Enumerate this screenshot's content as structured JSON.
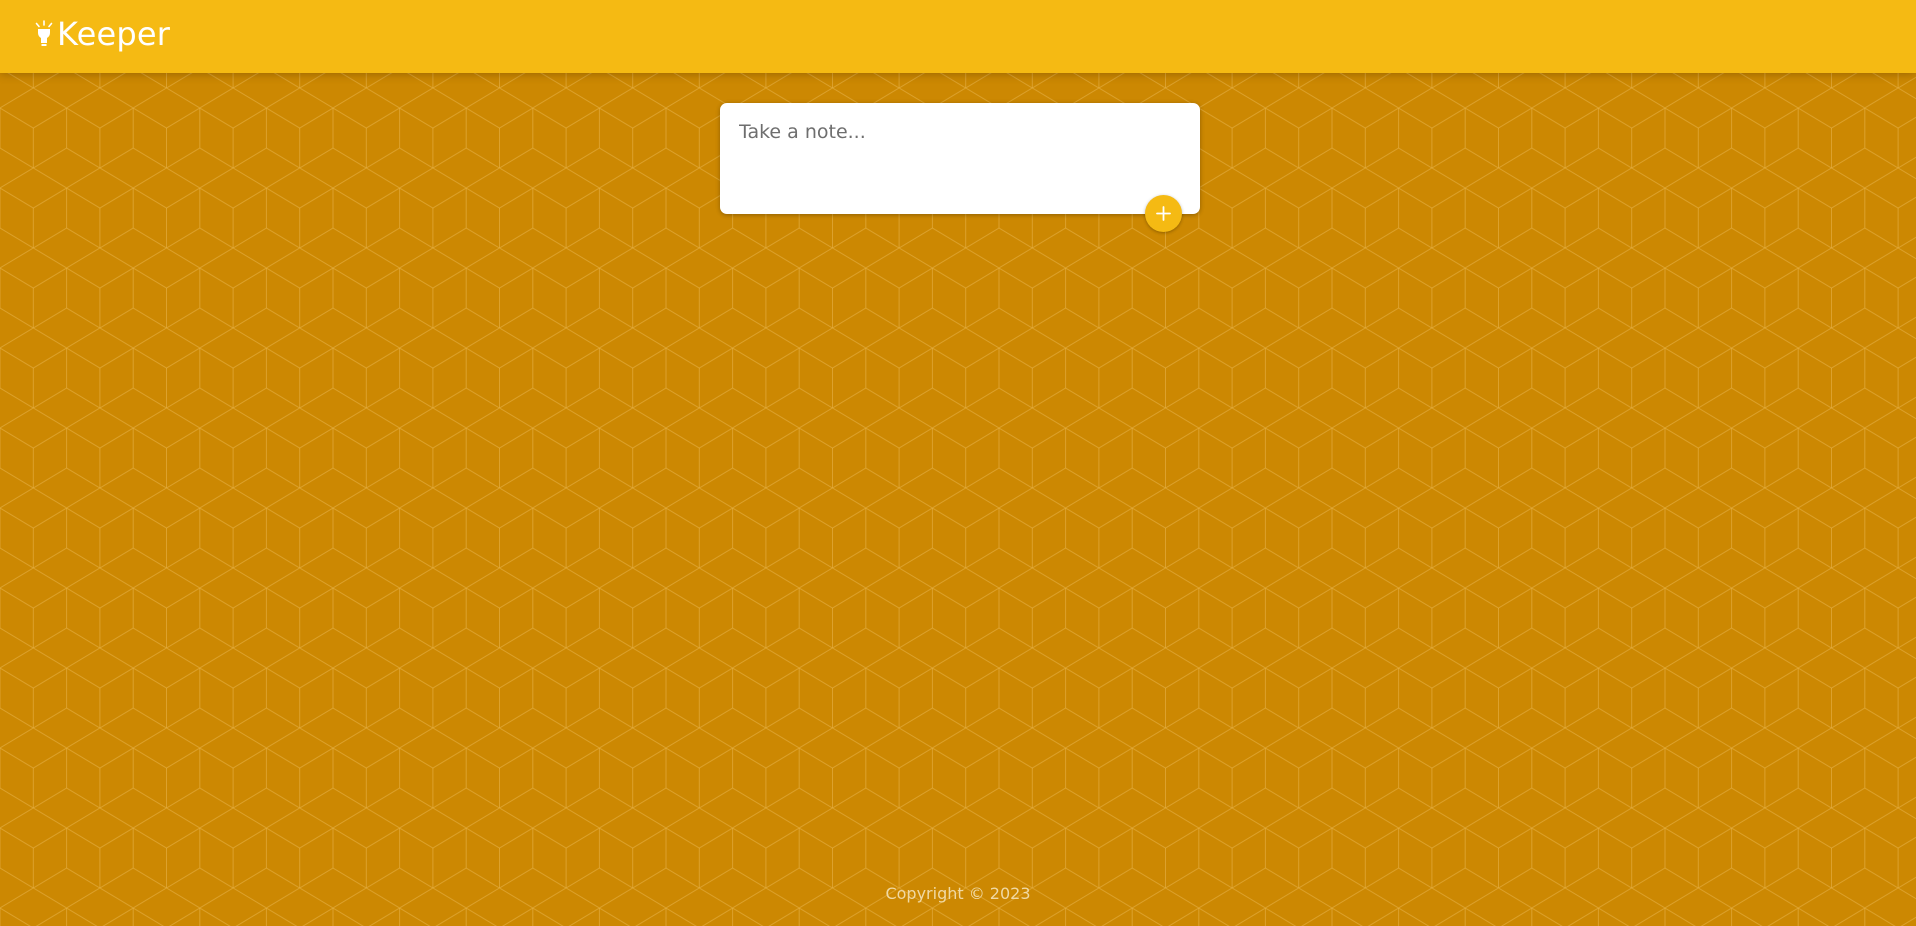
{
  "header": {
    "brand_title": "Keeper",
    "logo_icon": "lightbulb-icon"
  },
  "note_form": {
    "placeholder": "Take a note...",
    "value": "",
    "add_icon": "plus-icon"
  },
  "footer": {
    "copyright": "Copyright © 2023"
  },
  "colors": {
    "header_bg": "#f5ba13",
    "page_bg": "#cc8802",
    "accent": "#f5ba13",
    "card_bg": "#ffffff"
  }
}
